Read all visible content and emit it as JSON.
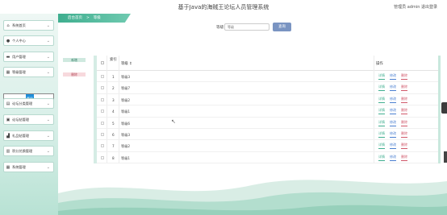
{
  "header": {
    "title": "基于Java的海贼王论坛人员管理系统",
    "user_text": "管理员 admin  退出登录"
  },
  "breadcrumb": {
    "home": "后台首页",
    "separator": ">",
    "current": "等级"
  },
  "sidebar": {
    "items": [
      {
        "icon": "home-icon",
        "glyph": "⌂",
        "label": "系统首页"
      },
      {
        "icon": "user-icon",
        "glyph": "●",
        "label": "个人中心"
      },
      {
        "icon": "users-icon",
        "glyph": "▬",
        "label": "用户管理"
      },
      {
        "icon": "grid-icon",
        "glyph": "▦",
        "label": "等级管理"
      },
      {
        "icon": "forum-icon",
        "glyph": "▤",
        "label": "论坛分类管理"
      },
      {
        "icon": "forum-icon",
        "glyph": "▣",
        "label": "论坛帖管理"
      },
      {
        "icon": "board-icon",
        "glyph": "▟",
        "label": "礼品帖管理"
      },
      {
        "icon": "points-icon",
        "glyph": "▥",
        "label": "积分兑换管理"
      },
      {
        "icon": "settings-icon",
        "glyph": "▦",
        "label": "系统管理"
      }
    ],
    "submenu": {
      "left": "≡",
      "active": "等级",
      "right": "≡"
    }
  },
  "search": {
    "label": "等级",
    "placeholder": "等级",
    "button": "查询"
  },
  "actions": {
    "add": "新增",
    "delete": "删除"
  },
  "table": {
    "headers": {
      "index": "索引",
      "name": "等级 ↕",
      "op": "操作"
    },
    "rows": [
      {
        "idx": "1",
        "name": "等级3"
      },
      {
        "idx": "2",
        "name": "等级7"
      },
      {
        "idx": "3",
        "name": "等级2"
      },
      {
        "idx": "4",
        "name": "等级1"
      },
      {
        "idx": "5",
        "name": "等级6"
      },
      {
        "idx": "6",
        "name": "等级3"
      },
      {
        "idx": "7",
        "name": "等级2"
      },
      {
        "idx": "8",
        "name": "等级1"
      }
    ],
    "row_actions": {
      "detail": "详情",
      "edit": "修改",
      "delete": "删除"
    }
  },
  "colors": {
    "accent": "#3fae8f",
    "search_button": "#7a94c2",
    "delete": "#d0586a",
    "edit": "#4a7fd0"
  }
}
